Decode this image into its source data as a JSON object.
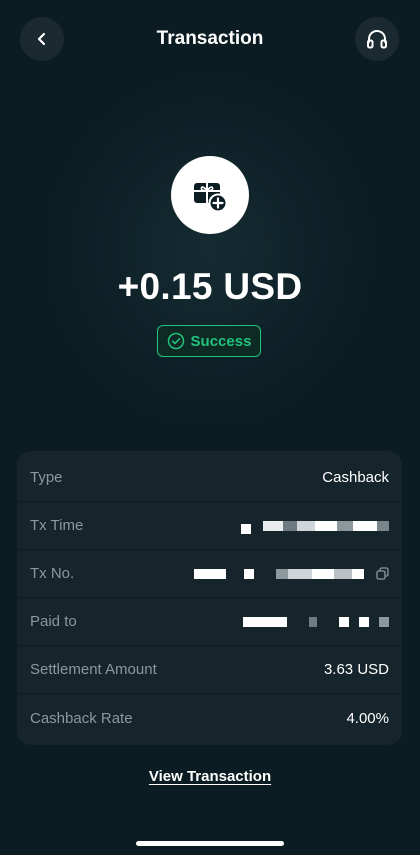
{
  "header": {
    "title": "Transaction",
    "back_icon": "chevron-left-icon",
    "support_icon": "headphones-icon"
  },
  "hero": {
    "icon": "gift-card-plus-icon",
    "amount": "+0.15 USD",
    "status": "Success",
    "status_icon": "check-circle-icon"
  },
  "details": [
    {
      "label": "Type",
      "value": "Cashback"
    },
    {
      "label": "Tx Time",
      "value": ""
    },
    {
      "label": "Tx No.",
      "value": ""
    },
    {
      "label": "Paid to",
      "value": ""
    },
    {
      "label": "Settlement Amount",
      "value": "3.63 USD"
    },
    {
      "label": "Cashback Rate",
      "value": "4.00%"
    }
  ],
  "footer": {
    "view_link": "View Transaction"
  },
  "colors": {
    "background": "#0b1c22",
    "card": "#16252b",
    "success": "#21c27d",
    "muted_text": "#8b989d"
  }
}
